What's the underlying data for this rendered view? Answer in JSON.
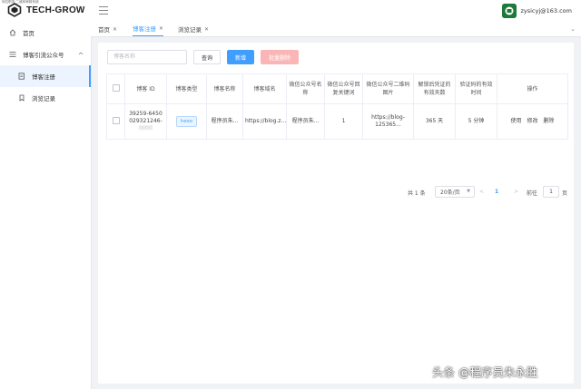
{
  "header": {
    "caption": "岗位职务·二维码审核系统",
    "brand": "TECH-GROW",
    "user_email": "zysicyj@163.com"
  },
  "sidebar": {
    "items": [
      {
        "label": "首页",
        "icon": "home-icon"
      },
      {
        "label": "博客引流公众号",
        "icon": "menu-icon"
      },
      {
        "label": "博客注册",
        "icon": "doc-icon",
        "active": true
      },
      {
        "label": "浏览记录",
        "icon": "bookmark-icon"
      }
    ]
  },
  "tabs": [
    {
      "label": "首页"
    },
    {
      "label": "博客注册",
      "active": true
    },
    {
      "label": "浏览记录"
    }
  ],
  "toolbar": {
    "search_placeholder": "博客名称",
    "query_label": "查询",
    "add_label": "新增",
    "batch_delete_label": "批量删除"
  },
  "table": {
    "headers": [
      "",
      "博客 ID",
      "博客类型",
      "博客名称",
      "博客域名",
      "微信公众号名称",
      "微信公众号回复关键词",
      "微信公众号二维码图片",
      "解锁后凭证的有效天数",
      "验证码的有效时间",
      "操作"
    ],
    "rows": [
      {
        "id_line1": "39259-6450",
        "id_line2": "029321246-",
        "id_line3": "0000",
        "type": "hexo",
        "name": "程序员朱...",
        "domain": "https://blog.z...",
        "wechat_name": "程序员朱...",
        "keyword": "1",
        "qrcode": "https://blog-125365...",
        "days": "365 天",
        "code_ttl": "5 分钟",
        "actions": [
          "使用",
          "修改",
          "删除"
        ]
      }
    ]
  },
  "pagination": {
    "total": "共 1 条",
    "page_size": "20条/页",
    "prev": "<",
    "current": "1",
    "next": ">",
    "goto_label": "前往",
    "goto_value": "1",
    "page_suffix": "页"
  },
  "watermark": "头条 @程序员朱永胜",
  "colors": {
    "accent": "#409eff",
    "danger_light": "#fab6b6",
    "brand_green": "#1e7a3a"
  }
}
